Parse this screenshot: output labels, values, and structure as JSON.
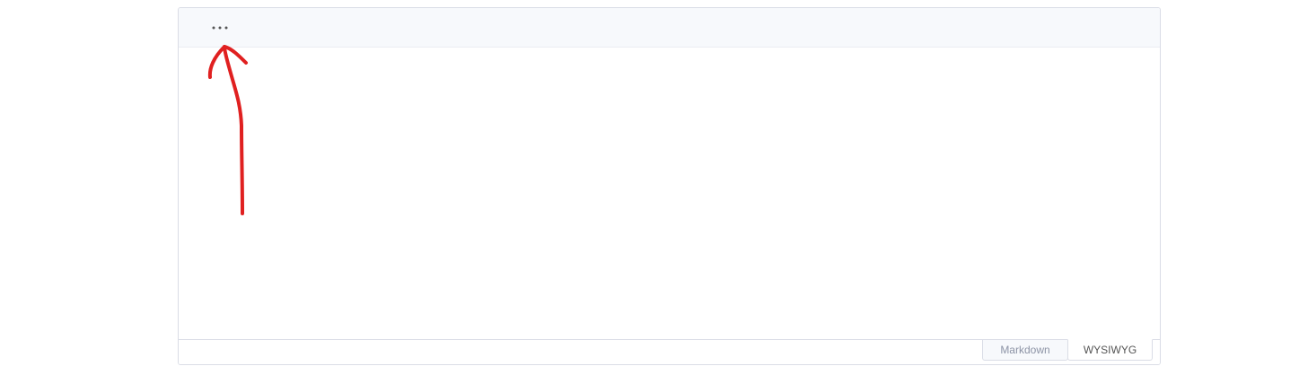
{
  "toolbar": {
    "more_icon": "ellipsis-icon"
  },
  "mode_switch": {
    "markdown_label": "Markdown",
    "wysiwyg_label": "WYSIWYG",
    "active": "WYSIWYG"
  },
  "annotation": {
    "shape": "hand-drawn-arrow",
    "color": "#e02020"
  }
}
